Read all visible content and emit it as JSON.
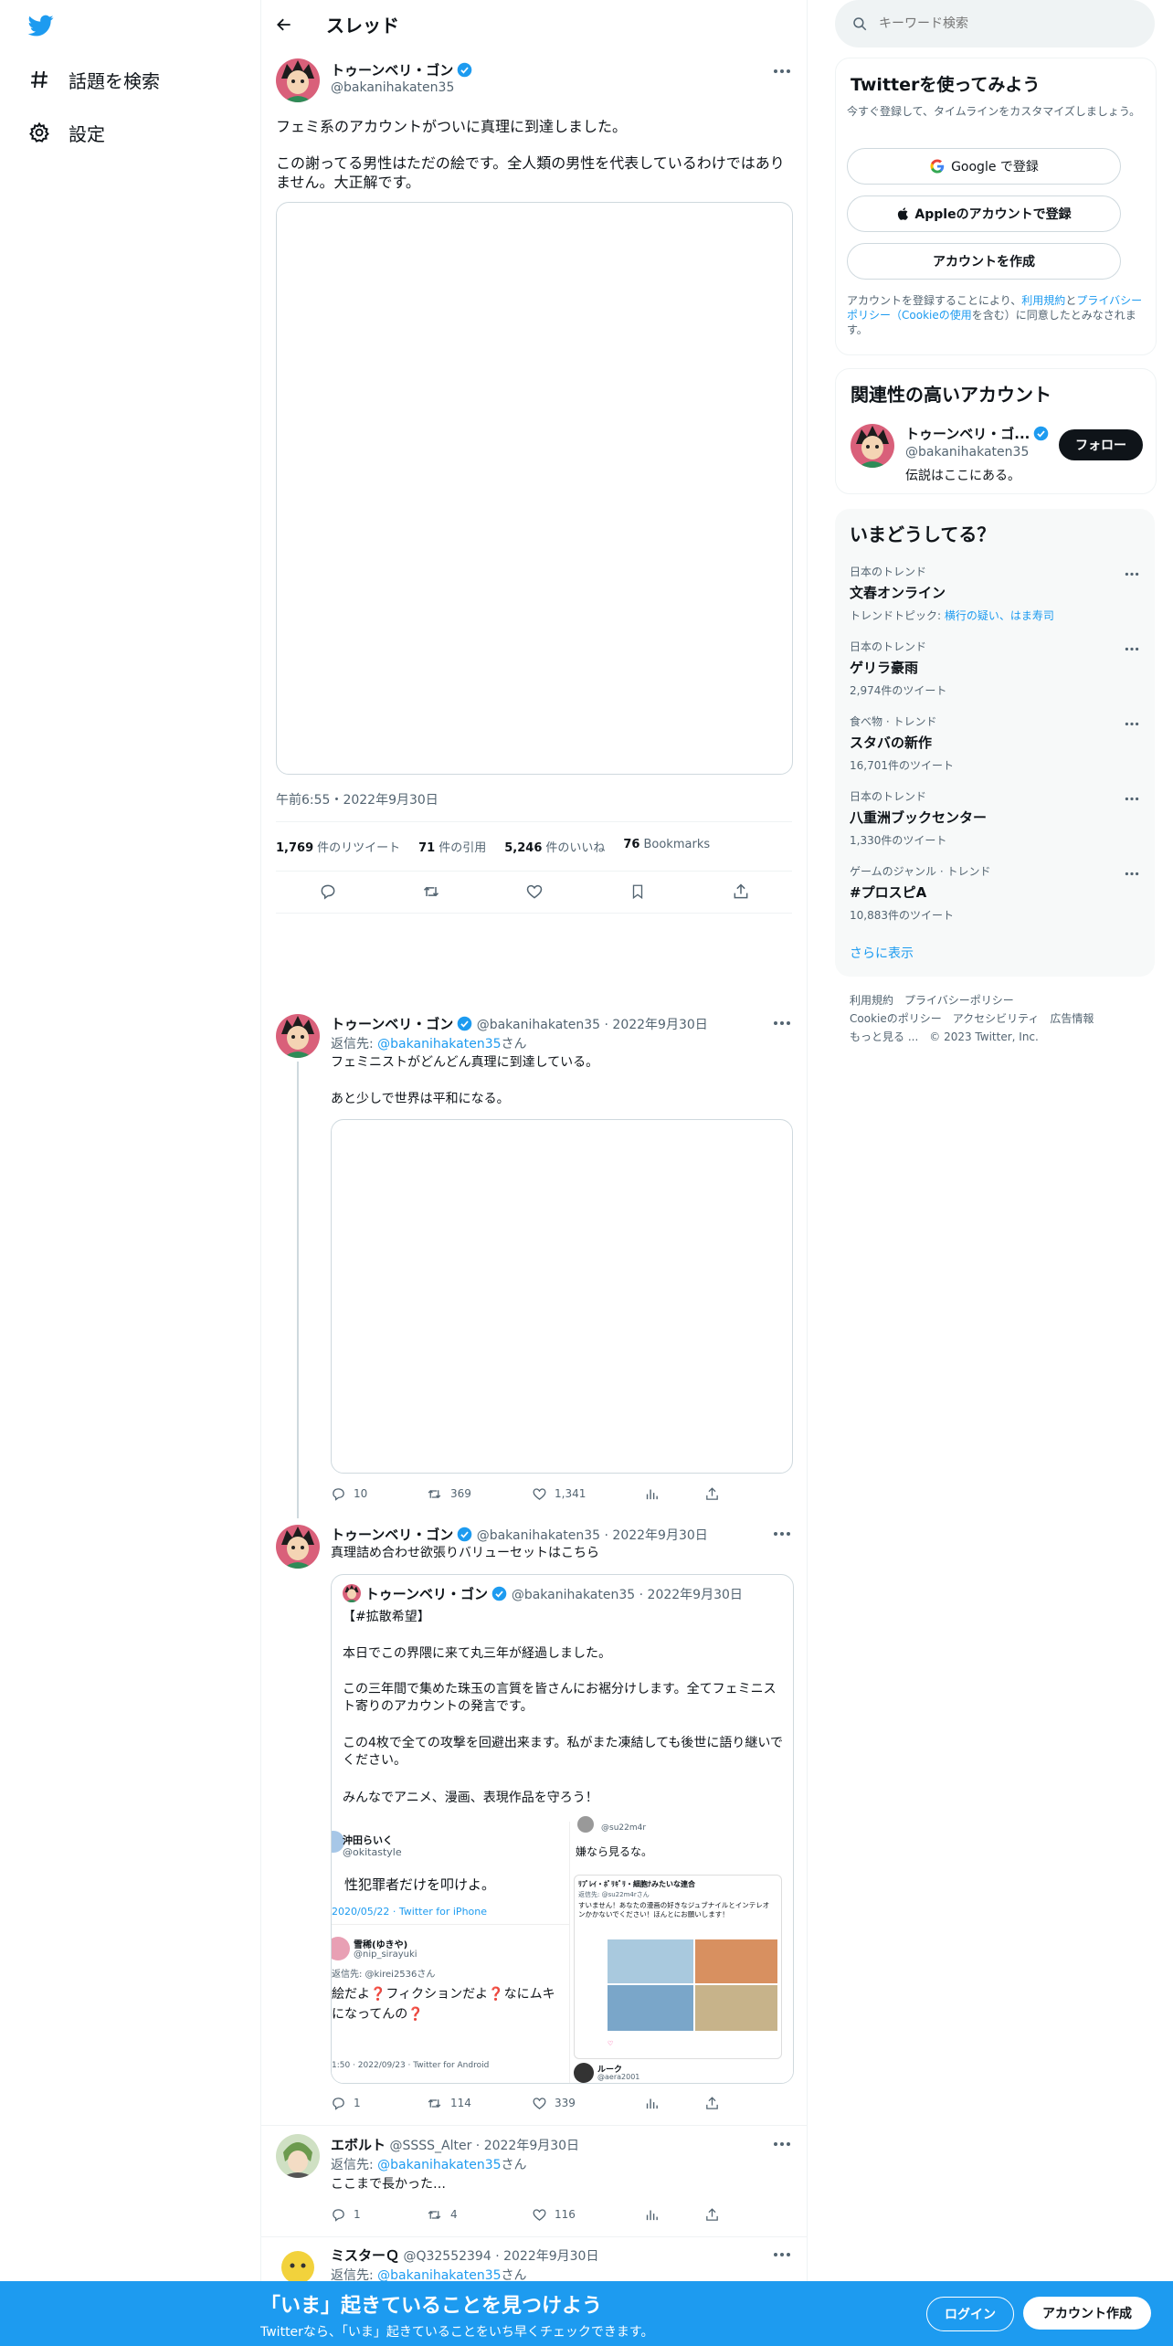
{
  "colors": {
    "accent": "#1d9bf0",
    "text": "#0f1419",
    "muted": "#536471",
    "border": "#cfd9de",
    "like": "#f91880"
  },
  "nav": {
    "logo_icon": "twitter-bird-icon",
    "items": [
      {
        "icon": "hashtag-icon",
        "label": "話題を検索"
      },
      {
        "icon": "gear-icon",
        "label": "設定"
      }
    ]
  },
  "header": {
    "title": "スレッド"
  },
  "main_tweet": {
    "author_name": "トゥーンベリ・ゴン",
    "handle": "@bakanihakaten35",
    "text1": "フェミ系のアカウントがついに真理に到達しました。",
    "text2": "この謝ってる男性はただの絵です。全人類の男性を代表しているわけではありません。大正解です。",
    "timestamp": "午前6:55・2022年9月30日",
    "stats": [
      {
        "value": "1,769",
        "label": "件のリツイート"
      },
      {
        "value": "71",
        "label": "件の引用"
      },
      {
        "value": "5,246",
        "label": "件のいいね"
      },
      {
        "value": "76",
        "label": "Bookmarks"
      }
    ]
  },
  "replies": [
    {
      "name": "トゥーンベリ・ゴン",
      "handle": "@bakanihakaten35 · 2022年9月30日",
      "reply_prefix": "返信先: ",
      "reply_to": "@bakanihakaten35",
      "reply_suffix": "さん",
      "text1": "フェミニストがどんどん真理に到達している。",
      "text2": "あと少しで世界は平和になる。",
      "replies": "10",
      "retweets": "369",
      "likes": "1,341"
    },
    {
      "name": "トゥーンベリ・ゴン",
      "handle": "@bakanihakaten35 · 2022年9月30日",
      "text1": "真理詰め合わせ欲張りバリューセットはこちら",
      "replies": "1",
      "retweets": "114",
      "likes": "339",
      "quote": {
        "name": "トゥーンベリ・ゴン",
        "handle": "@bakanihakaten35 · 2022年9月30日",
        "line1": "【#拡散希望】",
        "line2": "本日でこの界隈に来て丸三年が経過しました。",
        "line3": "この三年間で集めた珠玉の言質を皆さんにお裾分けします。全てフェミニスト寄りのアカウントの発言です。",
        "line4": "この4枚で全ての攻撃を回避出来ます。私がまた凍結しても後世に語り継いでください。",
        "line5": "みんなでアニメ、漫画、表現作品を守ろう！",
        "collage": {
          "a_name": "沖田らいく",
          "a_handle": "@okitastyle",
          "a_text": "性犯罪者だけを叩けよ。",
          "a_date": "2020/05/22 · Twitter for iPhone",
          "b_name": "雪稀(ゆきや)",
          "b_handle": "@nip_sirayuki",
          "b_reply": "返信先: @kirei2536さん",
          "b_text1": "絵だよ❓フィクションだよ❓なにムキ",
          "b_text2": "になってんの❓",
          "b_date": "1:50 · 2022/09/23 · Twitter for Android",
          "c_handle": "@su22m4r",
          "c_text": "嫌なら見るな。",
          "d_name": "ﾘﾌﾟﾚｲ・ﾎﾟﾘｷﾞﾘ・細胞ﾅみたいな連合",
          "d_reply": "返信先: @su22m4rさん",
          "d_text": "すいません！あなたの漫画の好きなジュブナイルとインテレオンかかないでください！ほんとにお願いします！",
          "e_name": "ルーク",
          "e_handle": "@aera2001"
        }
      }
    },
    {
      "name": "エボルト",
      "handle": "@SSSS_Alter · 2022年9月30日",
      "reply_prefix": "返信先: ",
      "reply_to": "@bakanihakaten35",
      "reply_suffix": "さん",
      "text1": "ここまで長かった…",
      "replies": "1",
      "retweets": "4",
      "likes": "116"
    },
    {
      "name": "ミスターＱ",
      "handle": "@Q32552394 · 2022年9月30日",
      "reply_prefix": "返信先: ",
      "reply_to": "@bakanihakaten35",
      "reply_suffix": "さん"
    }
  ],
  "sidebar": {
    "search_placeholder": "キーワード検索",
    "signup_card": {
      "title": "Twitterを使ってみよう",
      "subtitle": "今すぐ登録して、タイムラインをカスタマイズしましょう。",
      "google_btn": "Google で登録",
      "apple_btn": "Appleのアカウントで登録",
      "create_btn": "アカウントを作成",
      "legal_pre": "アカウントを登録することにより、",
      "legal_terms": "利用規約",
      "legal_and": "と",
      "legal_privacy": "プライバシーポリシー（Cookieの使用",
      "legal_post": "を含む）に同意したとみなされます。"
    },
    "related": {
      "title": "関連性の高いアカウント",
      "name": "トゥーンベリ・ゴ...",
      "handle": "@bakanihakaten35",
      "bio": "伝説はここにある。",
      "follow_btn": "フォロー"
    },
    "trends": {
      "title": "いまどうしてる？",
      "items": [
        {
          "category": "日本のトレンド",
          "title": "文春オンライン",
          "sub_prefix": "トレンドトピック: ",
          "sub_link": "横行の疑い、はま寿司"
        },
        {
          "category": "日本のトレンド",
          "title": "ゲリラ豪雨",
          "sub": "2,974件のツイート"
        },
        {
          "category": "食べ物 · トレンド",
          "title": "スタバの新作",
          "sub": "16,701件のツイート"
        },
        {
          "category": "日本のトレンド",
          "title": "八重洲ブックセンター",
          "sub": "1,330件のツイート"
        },
        {
          "category": "ゲームのジャンル · トレンド",
          "title": "#プロスピA",
          "sub": "10,883件のツイート"
        }
      ],
      "show_more": "さらに表示"
    },
    "footer": {
      "links": [
        "利用規約",
        "プライバシーポリシー",
        "Cookieのポリシー",
        "アクセシビリティ",
        "広告情報",
        "もっと見る ..."
      ],
      "copyright": "© 2023 Twitter, Inc."
    }
  },
  "bottom_bar": {
    "title": "「いま」起きていることを見つけよう",
    "subtitle": "Twitterなら、「いま」起きていることをいち早くチェックできます。",
    "login": "ログイン",
    "signup": "アカウント作成"
  }
}
